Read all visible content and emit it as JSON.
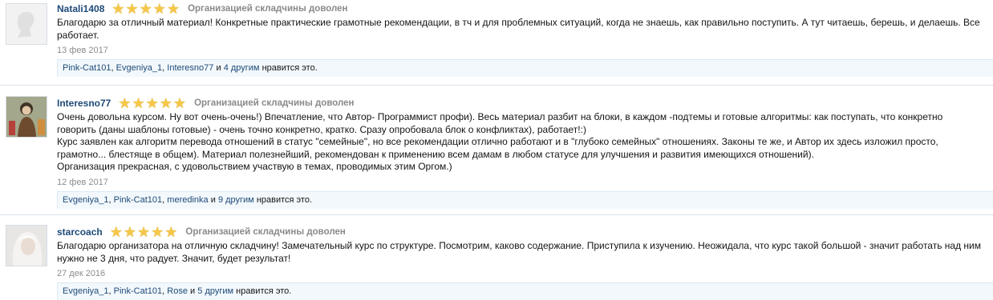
{
  "reviews": [
    {
      "username": "Natali1408",
      "rating": 5,
      "rating_label": "Организацией складчины доволен",
      "text": [
        "Благодарю за отличный материал! Конкретные практические грамотные рекомендации, в тч и для проблемных ситуаций, когда не знаешь, как правильно поступить. А тут читаешь, берешь, и делаешь. Все работает."
      ],
      "date": "13 фев 2017",
      "likes": {
        "users": [
          "Pink-Cat101",
          "Evgeniya_1",
          "Interesno77"
        ],
        "and": "и",
        "others": "4 другим",
        "suffix": "нравится это."
      }
    },
    {
      "username": "Interesno77",
      "rating": 5,
      "rating_label": "Организацией складчины доволен",
      "text": [
        "Очень довольна курсом. Ну вот очень-очень!) Впечатление, что Автор- Программист профи). Весь материал разбит на блоки, в каждом -подтемы и готовые алгоритмы: как поступать, что конкретно говорить (даны шаблоны готовые) - очень точно  конкретно, кратко. Сразу опробовала блок о конфликтах), работает!:)",
        "Курс заявлен как алгоритм перевода отношений в статус \"семейные\", но все рекомендации отлично работают и в \"глубоко семейных\" отношениях. Законы те же, и Автор их здесь изложил просто, грамотно... блестяще в общем). Материал полезнейший, рекомендован к применению всем дамам в любом статусе для улучшения и развития имеющихся отношений).",
        "Организация прекрасная, с удовольствием участвую в темах, проводимых этим Оргом.)"
      ],
      "date": "12 фев 2017",
      "likes": {
        "users": [
          "Evgeniya_1",
          "Pink-Cat101",
          "meredinka"
        ],
        "and": "и",
        "others": "9 другим",
        "suffix": "нравится это."
      }
    },
    {
      "username": "starcoach",
      "rating": 5,
      "rating_label": "Организацией складчины доволен",
      "text": [
        "Благодарю организатора на отличную складчину! Замечательный курс по структуре. Посмотрим, каково содержание. Приступила к изучению. Неожидала, что курс такой большой - значит работать над ним нужно не 3 дня, что радует. Значит, будет результат!"
      ],
      "date": "27 дек 2016",
      "likes": {
        "users": [
          "Evgeniya_1",
          "Pink-Cat101",
          "Rose"
        ],
        "and": "и",
        "others": "5 другим",
        "suffix": "нравится это."
      }
    }
  ],
  "colors": {
    "username": "#1e4a78",
    "star": "#f5c748",
    "likes_bg": "#f2f8fc",
    "muted": "#8c8c8c"
  }
}
